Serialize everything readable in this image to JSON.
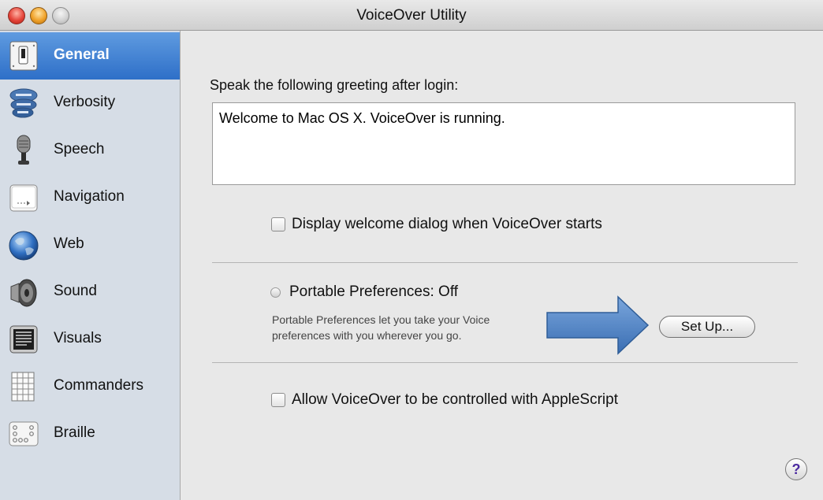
{
  "window": {
    "title": "VoiceOver Utility"
  },
  "sidebar": {
    "items": [
      {
        "label": "General",
        "icon": "switch-icon",
        "selected": true
      },
      {
        "label": "Verbosity",
        "icon": "speech-bubbles-icon",
        "selected": false
      },
      {
        "label": "Speech",
        "icon": "microphone-icon",
        "selected": false
      },
      {
        "label": "Navigation",
        "icon": "navigation-key-icon",
        "selected": false
      },
      {
        "label": "Web",
        "icon": "globe-icon",
        "selected": false
      },
      {
        "label": "Sound",
        "icon": "speaker-icon",
        "selected": false
      },
      {
        "label": "Visuals",
        "icon": "monitor-icon",
        "selected": false
      },
      {
        "label": "Commanders",
        "icon": "grid-icon",
        "selected": false
      },
      {
        "label": "Braille",
        "icon": "braille-dots-icon",
        "selected": false
      }
    ],
    "selected_color": "#3a7ed4"
  },
  "general": {
    "greeting_label": "Speak the following greeting after login:",
    "greeting_text": "Welcome to Mac OS X.  VoiceOver is running.",
    "welcome_dialog_label": "Display welcome dialog when VoiceOver starts",
    "welcome_dialog_checked": false,
    "portable_label": "Portable Preferences: Off",
    "portable_desc_line1": "Portable Preferences let you take your Voice",
    "portable_desc_line2": "preferences with you wherever you go.",
    "setup_button": "Set Up...",
    "applescript_label": "Allow VoiceOver to be controlled with AppleScript",
    "applescript_checked": false,
    "help": "?"
  },
  "annotation": {
    "arrow_color": "#4f82c4"
  }
}
